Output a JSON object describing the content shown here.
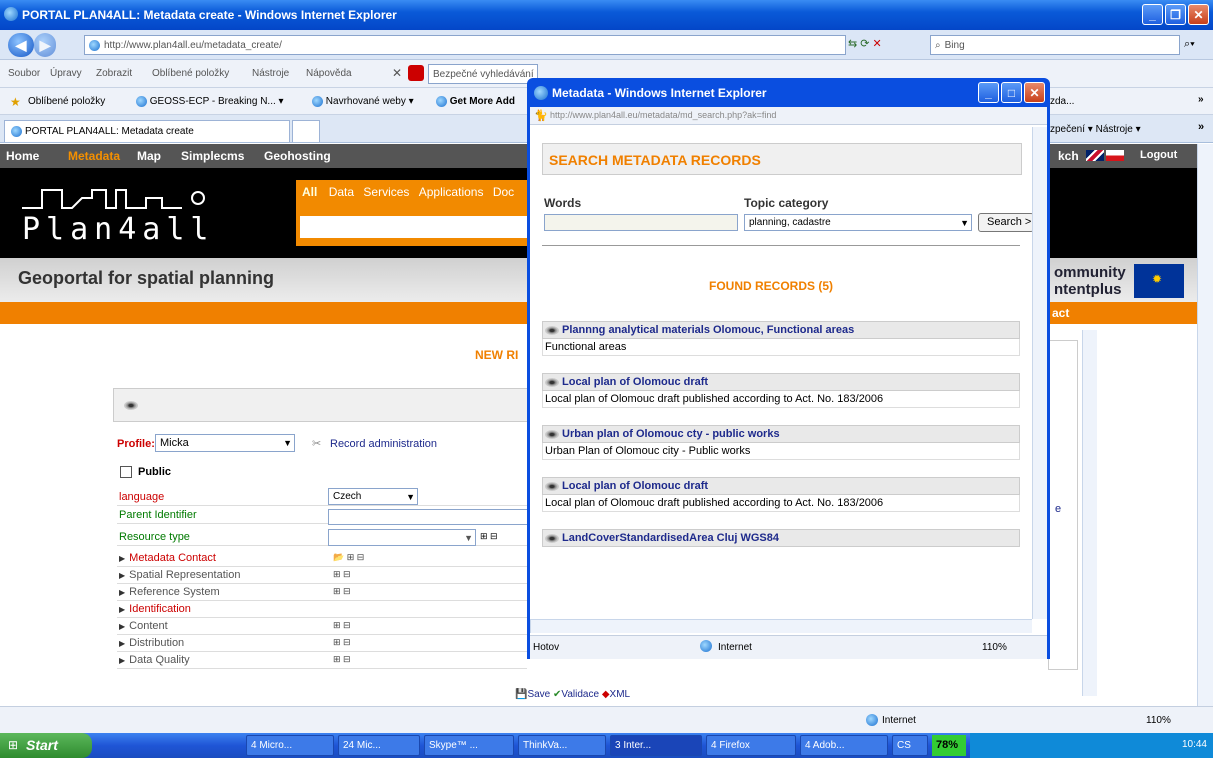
{
  "window": {
    "title": "PORTAL PLAN4ALL: Metadata create - Windows Internet Explorer"
  },
  "address": {
    "url": "http://www.plan4all.eu/metadata_create/",
    "search_placeholder": "Bing"
  },
  "menu": {
    "items": [
      "Soubor",
      "Úpravy",
      "Zobrazit",
      "Oblíbené položky",
      "Nástroje",
      "Nápověda"
    ],
    "mcafee_search": "Bezpečné vyhledávání",
    "mcafee": "McAfee"
  },
  "favorites": {
    "label": "Oblíbené položky",
    "items": [
      "GEOSS-ECP - Breaking N...",
      "Navrhované weby",
      "Get More Add"
    ]
  },
  "tabs": {
    "active": "PORTAL PLAN4ALL: Metadata create",
    "right_items": "zpečení ▾  Nástroje ▾",
    "right_extra": "zda..."
  },
  "site": {
    "nav": [
      "Home",
      "Metadata",
      "Map",
      "Simplecms",
      "Geohosting"
    ],
    "lang_text": "kch",
    "logout": "Logout",
    "logo_text": "Plan4all",
    "search_tabs": [
      "All",
      "Data",
      "Services",
      "Applications",
      "Doc"
    ],
    "title": "Geoportal for spatial planning",
    "eu_text1": "ommunity",
    "eu_text2": "ntentplus",
    "orange_right": "act",
    "new_record": "NEW RI",
    "profile_label": "Profile:",
    "profile_value": "Micka",
    "record_admin": "Record administration",
    "public_label": "Public",
    "fields": [
      {
        "label": "language",
        "value": "Czech",
        "color": "red"
      },
      {
        "label": "Parent Identifier",
        "value": "",
        "color": "green"
      },
      {
        "label": "Resource type",
        "value": "",
        "color": "green"
      }
    ],
    "sections": [
      {
        "label": "Metadata Contact",
        "color": "red"
      },
      {
        "label": "Spatial Representation",
        "color": "gray"
      },
      {
        "label": "Reference System",
        "color": "gray"
      },
      {
        "label": "Identification",
        "color": "red"
      },
      {
        "label": "Content",
        "color": "gray"
      },
      {
        "label": "Distribution",
        "color": "gray"
      },
      {
        "label": "Data Quality",
        "color": "gray"
      }
    ],
    "actions": [
      "Save",
      "Validace",
      "XML"
    ],
    "right_e": "e"
  },
  "popup": {
    "title": "Metadata - Windows Internet Explorer",
    "url": "http://www.plan4all.eu/metadata/md_search.php?ak=find",
    "heading": "SEARCH METADATA RECORDS",
    "words_label": "Words",
    "topic_label": "Topic category",
    "topic_value": "planning, cadastre",
    "search_button": "Search >",
    "found": "FOUND RECORDS (5)",
    "records": [
      {
        "title": "Plannng analytical materials Olomouc, Functional areas",
        "desc": "Functional areas"
      },
      {
        "title": "Local plan of Olomouc draft",
        "desc": "Local plan of Olomouc draft published according to Act. No. 183/2006"
      },
      {
        "title": "Urban plan of Olomouc cty - public works",
        "desc": "Urban Plan of Olomouc city - Public works"
      },
      {
        "title": "Local plan of Olomouc draft",
        "desc": "Local plan of Olomouc draft published according to Act. No. 183/2006"
      },
      {
        "title": "LandCoverStandardisedArea Cluj WGS84",
        "desc": ""
      }
    ],
    "status": "Hotov",
    "zone": "Internet",
    "zoom": "110%"
  },
  "status": {
    "zone": "Internet",
    "zoom": "110%"
  },
  "taskbar": {
    "start": "Start",
    "items": [
      "4 Micro...",
      "24 Mic...",
      "Skype™ ...",
      "ThinkVa...",
      "3 Inter...",
      "4 Firefox",
      "4 Adob...",
      "CS"
    ],
    "battery": "78%",
    "clock": "10:44"
  }
}
